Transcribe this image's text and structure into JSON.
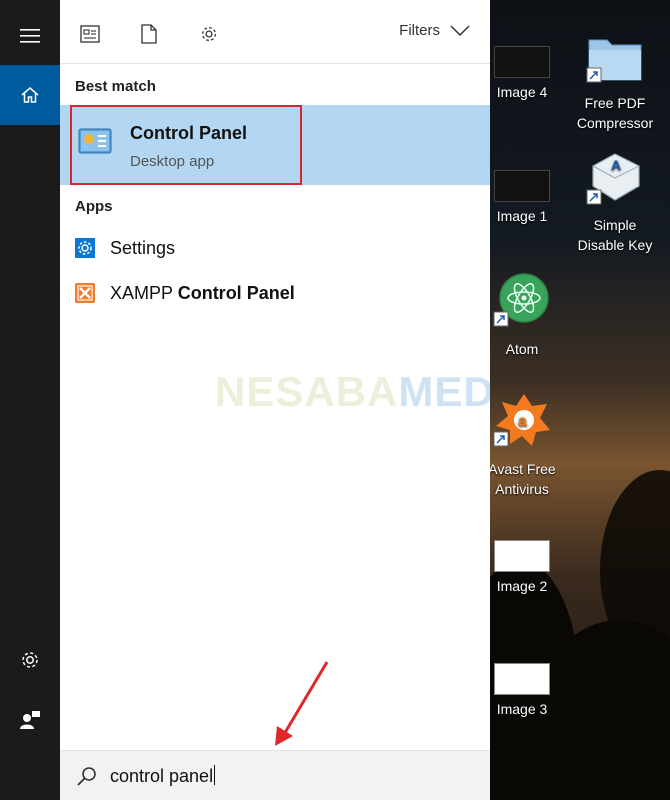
{
  "toolbar": {
    "filters_label": "Filters"
  },
  "search": {
    "best_match_heading": "Best match",
    "best_match": {
      "title": "Control Panel",
      "subtitle": "Desktop app"
    },
    "apps_heading": "Apps",
    "apps": [
      {
        "label": "Settings"
      },
      {
        "label_prefix": "XAMPP ",
        "label_bold": "Control Panel"
      }
    ],
    "query": "control panel"
  },
  "watermark": {
    "part1": "NESABA",
    "part2": "MEDIA"
  },
  "desktop": {
    "icons": [
      {
        "label": "Image 4"
      },
      {
        "label_line1": "Free PDF",
        "label_line2": "Compressor"
      },
      {
        "label": "Image 1"
      },
      {
        "label_line1": "Simple",
        "label_line2": "Disable Key"
      },
      {
        "label": "Atom"
      },
      {
        "label_line1": "Avast Free",
        "label_line2": "Antivirus"
      },
      {
        "label": "Image 2"
      },
      {
        "label": "Image 3"
      }
    ]
  },
  "colors": {
    "rail_bg": "#1b1b1b",
    "home_accent": "#005a9e",
    "best_match_bg": "#b3d7f2",
    "highlight_box": "#d8272e",
    "annotation_arrow": "#e0272b"
  },
  "icons": {
    "rail": [
      "hamburger-icon",
      "home-icon",
      "settings-gear-icon",
      "user-feedback-icon"
    ],
    "toolbar": [
      "apps-view-icon",
      "document-icon",
      "settings-gear-icon",
      "chevron-down-icon"
    ],
    "search": "search-icon"
  }
}
